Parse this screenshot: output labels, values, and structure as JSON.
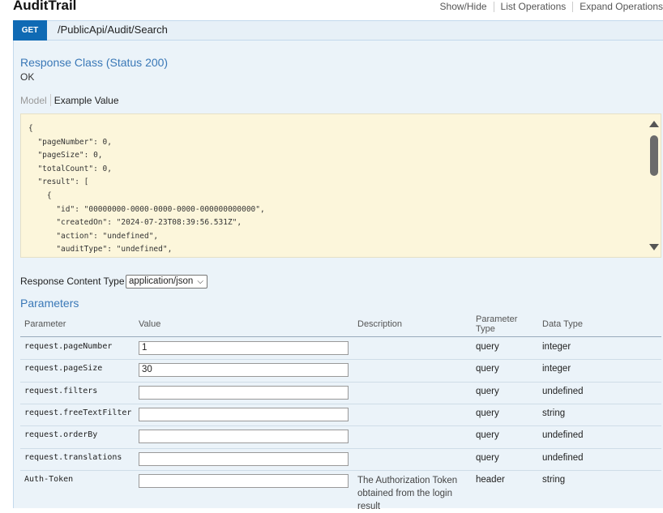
{
  "header": {
    "title": "AuditTrail",
    "links": [
      "Show/Hide",
      "List Operations",
      "Expand Operations"
    ]
  },
  "endpoint": {
    "method": "GET",
    "path": "/PublicApi/Audit/Search"
  },
  "response": {
    "class_title": "Response Class (Status 200)",
    "status_text": "OK",
    "tab_model": "Model",
    "tab_example": "Example Value",
    "example_json": "{\n  \"pageNumber\": 0,\n  \"pageSize\": 0,\n  \"totalCount\": 0,\n  \"result\": [\n    {\n      \"id\": \"00000000-0000-0000-0000-000000000000\",\n      \"createdOn\": \"2024-07-23T08:39:56.531Z\",\n      \"action\": \"undefined\",\n      \"auditType\": \"undefined\","
  },
  "content_type": {
    "label": "Response Content Type",
    "selected": "application/json"
  },
  "parameters": {
    "title": "Parameters",
    "headers": {
      "parameter": "Parameter",
      "value": "Value",
      "description": "Description",
      "parameter_type_line1": "Parameter",
      "parameter_type_line2": "Type",
      "data_type": "Data Type"
    },
    "rows": [
      {
        "name": "request.pageNumber",
        "value": "1",
        "description": "",
        "param_type": "query",
        "data_type": "integer"
      },
      {
        "name": "request.pageSize",
        "value": "30",
        "description": "",
        "param_type": "query",
        "data_type": "integer"
      },
      {
        "name": "request.filters",
        "value": "",
        "description": "",
        "param_type": "query",
        "data_type": "undefined"
      },
      {
        "name": "request.freeTextFilter",
        "value": "",
        "description": "",
        "param_type": "query",
        "data_type": "string"
      },
      {
        "name": "request.orderBy",
        "value": "",
        "description": "",
        "param_type": "query",
        "data_type": "undefined"
      },
      {
        "name": "request.translations",
        "value": "",
        "description": "",
        "param_type": "query",
        "data_type": "undefined"
      },
      {
        "name": "Auth-Token",
        "value": "",
        "description": "The Authorization Token obtained from the login result",
        "param_type": "header",
        "data_type": "string"
      }
    ]
  },
  "colors": {
    "get_badge": "#0f6ab4",
    "section_title": "#3a78b7",
    "endpoint_bg": "#e7f0f7",
    "json_bg": "#fcf6db"
  }
}
